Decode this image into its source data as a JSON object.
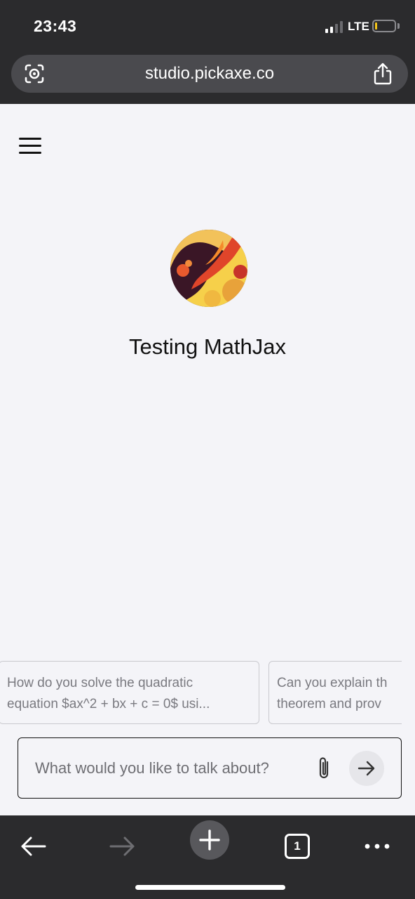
{
  "status_bar": {
    "time": "23:43",
    "network": "LTE",
    "signal_bars_active": 2,
    "signal_bars_total": 4,
    "battery_level": 0.1,
    "battery_color": "#f5c518"
  },
  "browser": {
    "url": "studio.pickaxe.co",
    "left_icon": "camera-search-icon",
    "right_icon": "share-icon",
    "toolbar": {
      "back_icon": "arrow-left-icon",
      "forward_icon": "arrow-right-icon",
      "new_tab_icon": "plus-icon",
      "tab_count": "1",
      "more_icon": "ellipsis-icon"
    }
  },
  "page": {
    "menu_icon": "hamburger-icon",
    "title": "Testing MathJax",
    "suggestions": [
      {
        "text": "How do you solve the quadratic\nequation $ax^2 + bx + c = 0$ usi..."
      },
      {
        "text": "Can you explain th\ntheorem and prov"
      }
    ],
    "input": {
      "placeholder": "What would you like to talk about?",
      "value": "",
      "attach_icon": "paperclip-icon",
      "send_icon": "arrow-right-icon"
    }
  },
  "colors": {
    "chrome_bg": "#2b2b2d",
    "url_bar_bg": "#4a4a4e",
    "page_bg": "#f4f4f8",
    "suggestion_text": "#7a7a80"
  }
}
